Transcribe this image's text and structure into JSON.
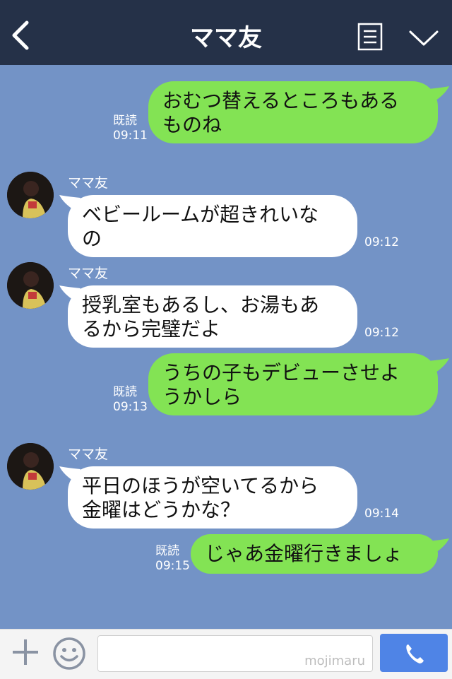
{
  "header": {
    "title": "ママ友",
    "icons": [
      "back-arrow-icon",
      "menu-list-icon",
      "chevron-down-icon"
    ]
  },
  "messages": [
    {
      "side": "me",
      "text": "おむつ替えるところもある\nものね",
      "read": "既読",
      "time": "09:11"
    },
    {
      "side": "them",
      "name": "ママ友",
      "text": "ベビールームが超きれいな\nの",
      "time": "09:12"
    },
    {
      "side": "them",
      "name": "ママ友",
      "text": "授乳室もあるし、お湯もあ\nるから完璧だよ",
      "time": "09:12"
    },
    {
      "side": "me",
      "text": "うちの子もデビューさせよ\nうかしら",
      "read": "既読",
      "time": "09:13"
    },
    {
      "side": "them",
      "name": "ママ友",
      "text": "平日のほうが空いてるから\n金曜はどうかな？",
      "time": "09:14"
    },
    {
      "side": "me",
      "text": "じゃあ金曜行きましょ",
      "read": "既読",
      "time": "09:15"
    }
  ],
  "footer": {
    "watermark": "mojimaru",
    "icons": [
      "plus-icon",
      "smiley-icon",
      "phone-icon"
    ]
  },
  "colors": {
    "header_bg": "#253148",
    "chat_bg": "#7393c6",
    "my_bubble": "#83e354",
    "their_bubble": "#ffffff",
    "call_button": "#4f84e6"
  }
}
